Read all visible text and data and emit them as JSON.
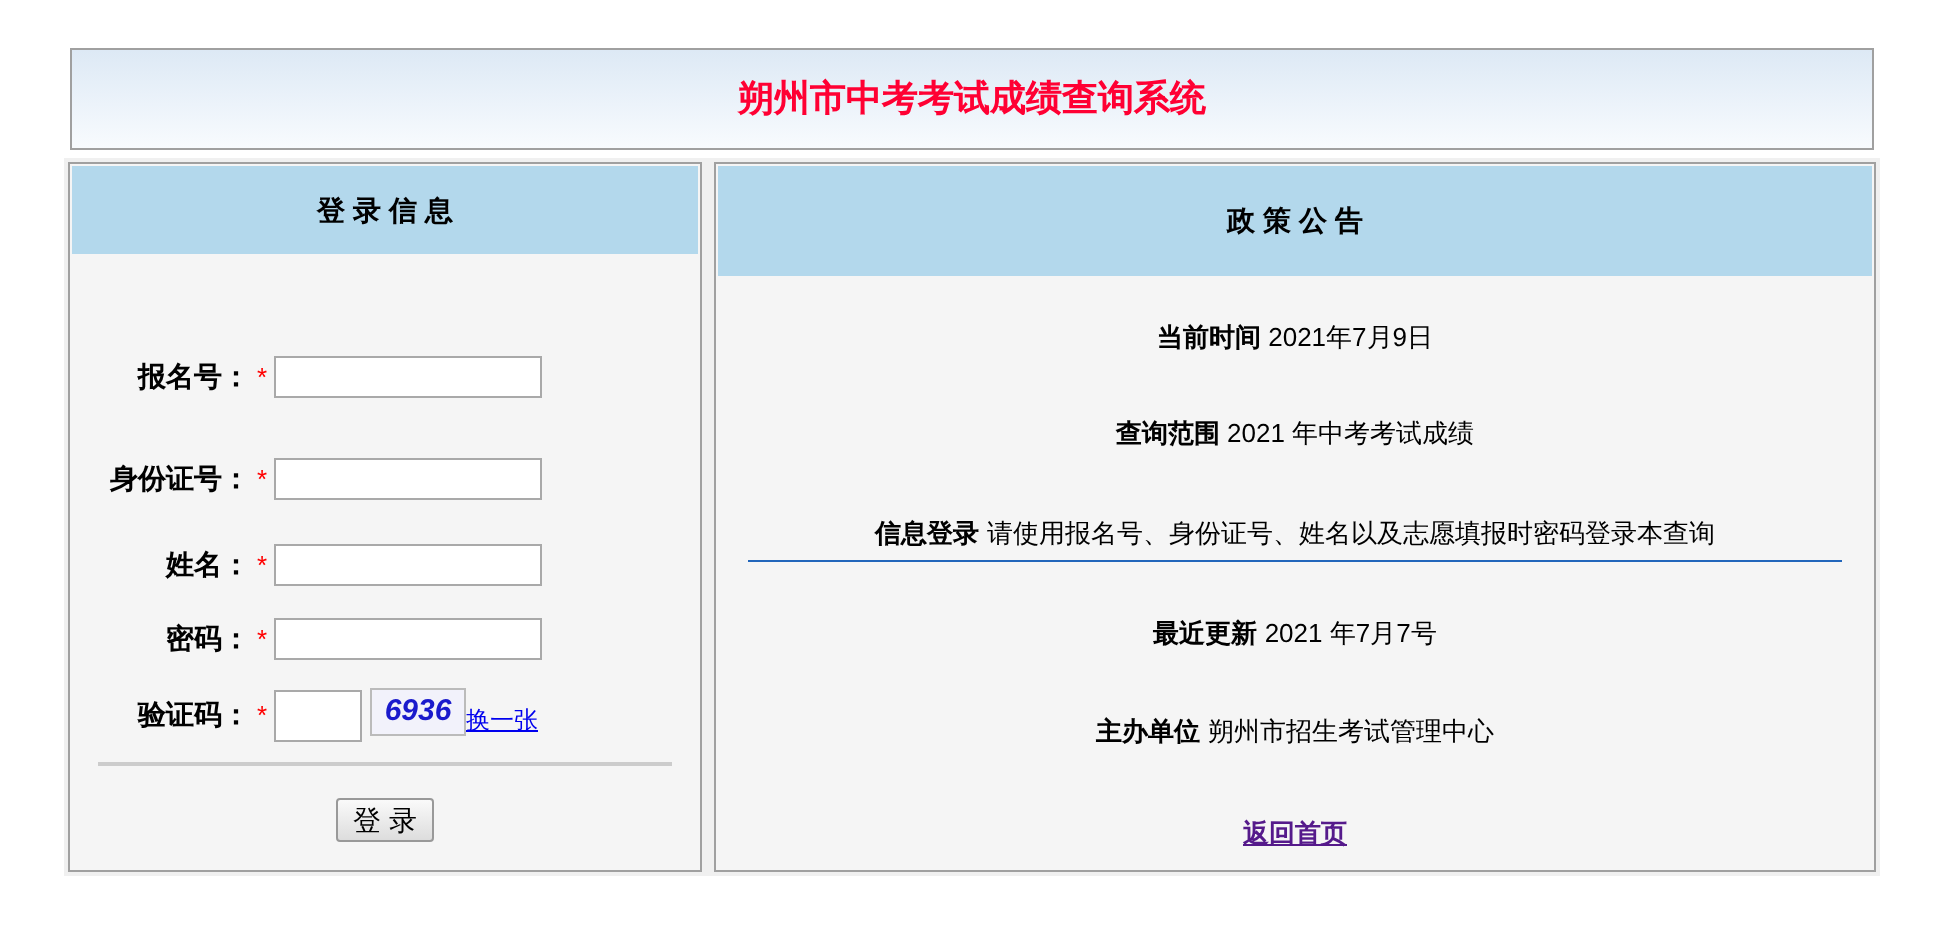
{
  "header": {
    "title": "朔州市中考考试成绩查询系统"
  },
  "login": {
    "title": "登 录 信 息",
    "fields": [
      {
        "label": "报名号：",
        "required_mark": "*",
        "kind": "text"
      },
      {
        "label": "身份证号：",
        "required_mark": "*",
        "kind": "text"
      },
      {
        "label": "姓名：",
        "required_mark": "*",
        "kind": "text"
      },
      {
        "label": "密码：",
        "required_mark": "*",
        "kind": "password"
      },
      {
        "label": "验证码：",
        "required_mark": "*",
        "kind": "captcha"
      }
    ],
    "captcha": {
      "code": "6936",
      "refresh_link": "换一张"
    },
    "submit": "登 录"
  },
  "notice": {
    "title": "政 策 公 告",
    "rows": [
      {
        "label": "当前时间",
        "value": "2021年7月9日",
        "divider": false
      },
      {
        "label": "查询范围",
        "value": "2021 年中考考试成绩",
        "divider": false
      },
      {
        "label": "信息登录",
        "value": "请使用报名号、身份证号、姓名以及志愿填报时密码登录本查询",
        "divider": true
      },
      {
        "label": "最近更新",
        "value": "2021 年7月7号",
        "divider": false
      },
      {
        "label": "主办单位",
        "value": "朔州市招生考试管理中心",
        "divider": false
      }
    ],
    "back_link": "返回首页"
  }
}
